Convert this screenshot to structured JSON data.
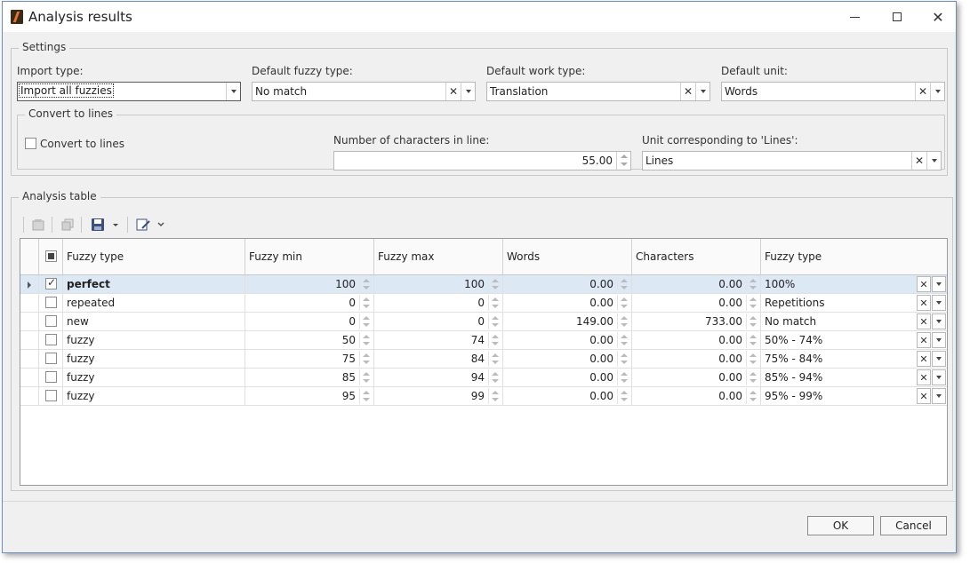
{
  "window": {
    "title": "Analysis results"
  },
  "settings": {
    "legend": "Settings",
    "import_type": {
      "label": "Import type:",
      "value": "Import all fuzzies"
    },
    "default_fuzzy_type": {
      "label": "Default fuzzy type:",
      "value": "No match"
    },
    "default_work_type": {
      "label": "Default work type:",
      "value": "Translation"
    },
    "default_unit": {
      "label": "Default unit:",
      "value": "Words"
    },
    "convert": {
      "legend": "Convert to lines",
      "checkbox_label": "Convert to lines",
      "checked": false,
      "chars_label": "Number of characters in line:",
      "chars_value": "55.00",
      "unit_label": "Unit corresponding to 'Lines':",
      "unit_value": "Lines"
    }
  },
  "analysis": {
    "legend": "Analysis table",
    "toolbar_icons": [
      "delete-row-icon",
      "copy-icon",
      "save-icon",
      "save-dropdown-icon",
      "edit-icon",
      "edit-dropdown-icon"
    ],
    "columns": [
      "Fuzzy type",
      "Fuzzy min",
      "Fuzzy max",
      "Words",
      "Characters",
      "Fuzzy type"
    ],
    "rows": [
      {
        "checked": true,
        "fuzzy_type": "perfect",
        "min": "100",
        "max": "100",
        "words": "0.00",
        "chars": "0.00",
        "type": "100%"
      },
      {
        "checked": false,
        "fuzzy_type": "repeated",
        "min": "0",
        "max": "0",
        "words": "0.00",
        "chars": "0.00",
        "type": "Repetitions"
      },
      {
        "checked": false,
        "fuzzy_type": "new",
        "min": "0",
        "max": "0",
        "words": "149.00",
        "chars": "733.00",
        "type": "No match"
      },
      {
        "checked": false,
        "fuzzy_type": "fuzzy",
        "min": "50",
        "max": "74",
        "words": "0.00",
        "chars": "0.00",
        "type": "50% - 74%"
      },
      {
        "checked": false,
        "fuzzy_type": "fuzzy",
        "min": "75",
        "max": "84",
        "words": "0.00",
        "chars": "0.00",
        "type": "75% - 84%"
      },
      {
        "checked": false,
        "fuzzy_type": "fuzzy",
        "min": "85",
        "max": "94",
        "words": "0.00",
        "chars": "0.00",
        "type": "85% - 94%"
      },
      {
        "checked": false,
        "fuzzy_type": "fuzzy",
        "min": "95",
        "max": "99",
        "words": "0.00",
        "chars": "0.00",
        "type": "95% - 99%"
      }
    ]
  },
  "buttons": {
    "ok": "OK",
    "cancel": "Cancel"
  },
  "colors": {
    "selected_row": "#dde8f5",
    "window_bg": "#f0f0f0",
    "border": "#6b8fb8"
  }
}
